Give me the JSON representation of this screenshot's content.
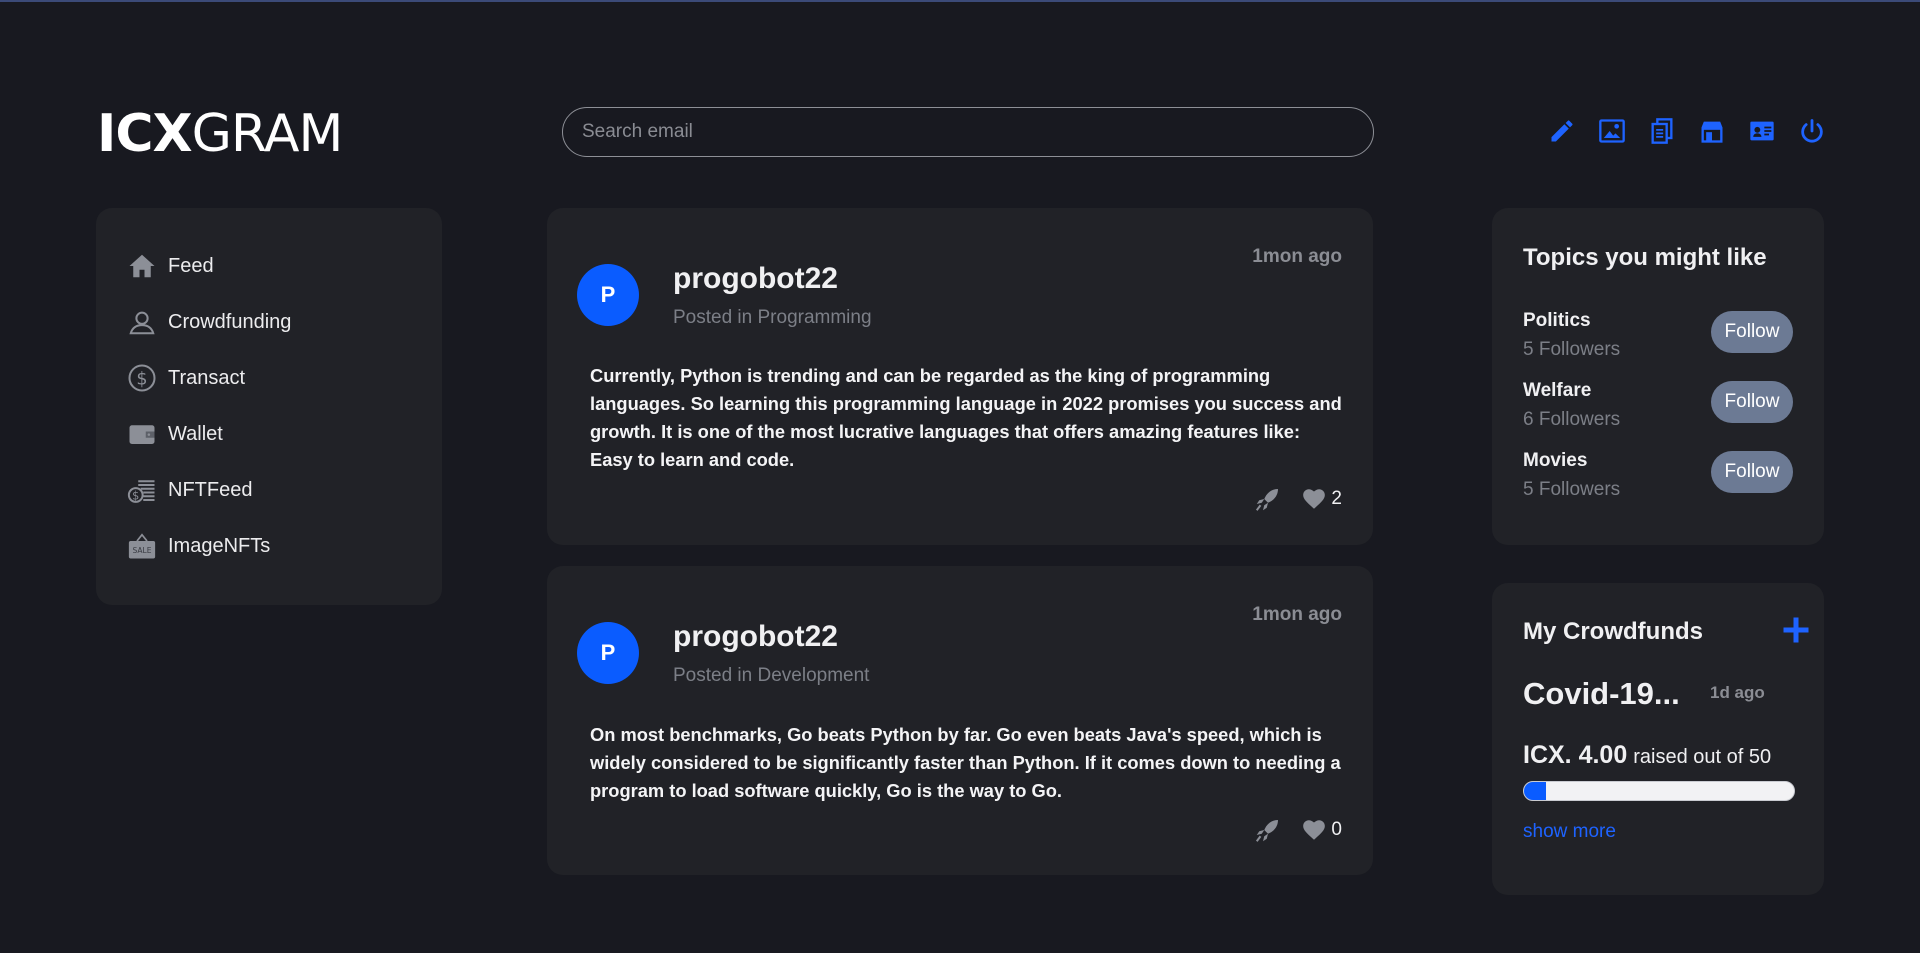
{
  "app": {
    "logo_bold": "ICX",
    "logo_light": "GRAM"
  },
  "search": {
    "placeholder": "Search email",
    "value": ""
  },
  "toolbar": {
    "icons": [
      "pencil-icon",
      "image-icon",
      "documents-icon",
      "shop-icon",
      "id-card-icon",
      "power-icon"
    ],
    "accent_color": "#0a5cff"
  },
  "sidebar": {
    "items": [
      {
        "label": "Feed",
        "icon": "home-icon"
      },
      {
        "label": "Crowdfunding",
        "icon": "person-icon"
      },
      {
        "label": "Transact",
        "icon": "dollar-circle-icon"
      },
      {
        "label": "Wallet",
        "icon": "wallet-icon"
      },
      {
        "label": "NFTFeed",
        "icon": "coin-stack-icon"
      },
      {
        "label": "ImageNFTs",
        "icon": "sale-sign-icon"
      }
    ]
  },
  "posts": [
    {
      "avatar_letter": "P",
      "author": "progobot22",
      "category": "Posted in Programming",
      "time": "1mon ago",
      "body": "Currently, Python is trending and can be regarded as the king of programming languages. So learning this programming language in 2022 promises you success and growth. It is one of the most lucrative languages that offers amazing features like: Easy to learn and code.",
      "likes": "2"
    },
    {
      "avatar_letter": "P",
      "author": "progobot22",
      "category": "Posted in Development",
      "time": "1mon ago",
      "body": "On most benchmarks, Go beats Python by far. Go even beats Java's speed, which is widely considered to be significantly faster than Python. If it comes down to needing a program to load software quickly, Go is the way to Go.",
      "likes": "0"
    }
  ],
  "topics": {
    "title": "Topics you might like",
    "items": [
      {
        "name": "Politics",
        "followers": "5 Followers",
        "button": "Follow"
      },
      {
        "name": "Welfare",
        "followers": "6 Followers",
        "button": "Follow"
      },
      {
        "name": "Movies",
        "followers": "5 Followers",
        "button": "Follow"
      }
    ]
  },
  "crowdfunds": {
    "title": "My Crowdfunds",
    "name": "Covid-19...",
    "ago": "1d ago",
    "amount": "ICX. 4.00",
    "raised_text": "raised out of 50",
    "progress_fraction": 0.08,
    "show_more": "show more"
  }
}
